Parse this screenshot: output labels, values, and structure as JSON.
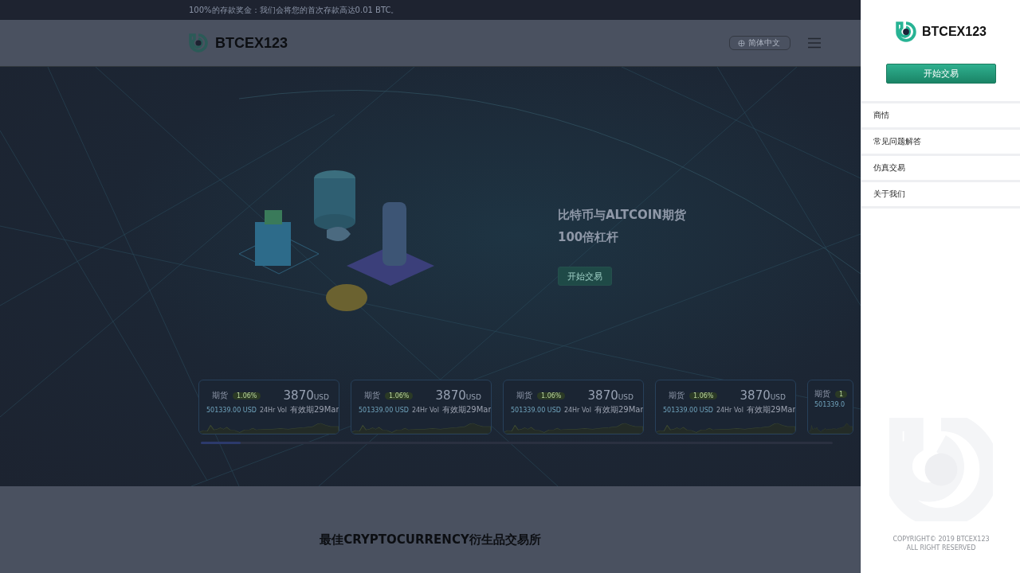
{
  "announcement": "100%的存款奖金：我们会将您的首次存款高达0.01 BTC。",
  "header": {
    "brand": "BTCEX123",
    "language": "简体中文"
  },
  "hero": {
    "title": "比特币与ALTCOIN期货",
    "subtitle": "100倍杠杆",
    "button": "开始交易"
  },
  "cards": [
    {
      "label": "期货",
      "change": "1.06%",
      "price": "3870",
      "unit": "USD",
      "volume": "501339.00 USD",
      "vol_label": "24Hr Vol",
      "expiry": "有效期29Mar"
    },
    {
      "label": "期货",
      "change": "1.06%",
      "price": "3870",
      "unit": "USD",
      "volume": "501339.00 USD",
      "vol_label": "24Hr Vol",
      "expiry": "有效期29Mar"
    },
    {
      "label": "期货",
      "change": "1.06%",
      "price": "3870",
      "unit": "USD",
      "volume": "501339.00 USD",
      "vol_label": "24Hr Vol",
      "expiry": "有效期29Mar"
    },
    {
      "label": "期货",
      "change": "1.06%",
      "price": "3870",
      "unit": "USD",
      "volume": "501339.00 USD",
      "vol_label": "24Hr Vol",
      "expiry": "有效期29Mar"
    },
    {
      "label": "期货",
      "change": "1",
      "volume": "501339.0"
    }
  ],
  "section_title": "最佳CRYPTOCURRENCY衍生品交易所",
  "drawer": {
    "brand": "BTCEX123",
    "button": "开始交易",
    "items": [
      {
        "label": "商情"
      },
      {
        "label": "常见问题解答"
      },
      {
        "label": "仿真交易"
      },
      {
        "label": "关于我们"
      }
    ],
    "copyright": [
      "COPYRIGHT© 2019 BTCEX123",
      "ALL RIGHT RESERVED"
    ]
  }
}
